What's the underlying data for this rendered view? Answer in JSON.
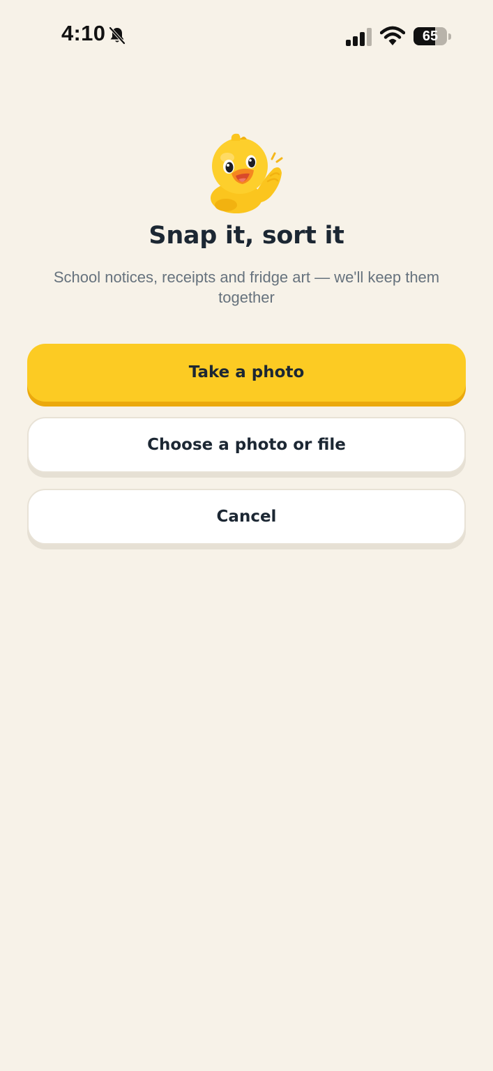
{
  "status_bar": {
    "time": "4:10",
    "battery_level": "65",
    "battery_fraction": 0.65,
    "icons": [
      "bell-slash-icon",
      "cellular-signal-icon",
      "wifi-icon",
      "battery-icon"
    ]
  },
  "hero": {
    "illustration": "waving-duckling-icon",
    "title": "Snap it, sort it",
    "subtitle": "School notices, receipts and fridge art — we'll keep them together"
  },
  "actions": {
    "take_photo": "Take a photo",
    "choose_file": "Choose a photo or file",
    "cancel": "Cancel"
  },
  "colors": {
    "background": "#f7f2e8",
    "primary": "#fccb23",
    "primary_shadow": "#eba90d",
    "text": "#1c2733",
    "muted_text": "#66727d"
  }
}
